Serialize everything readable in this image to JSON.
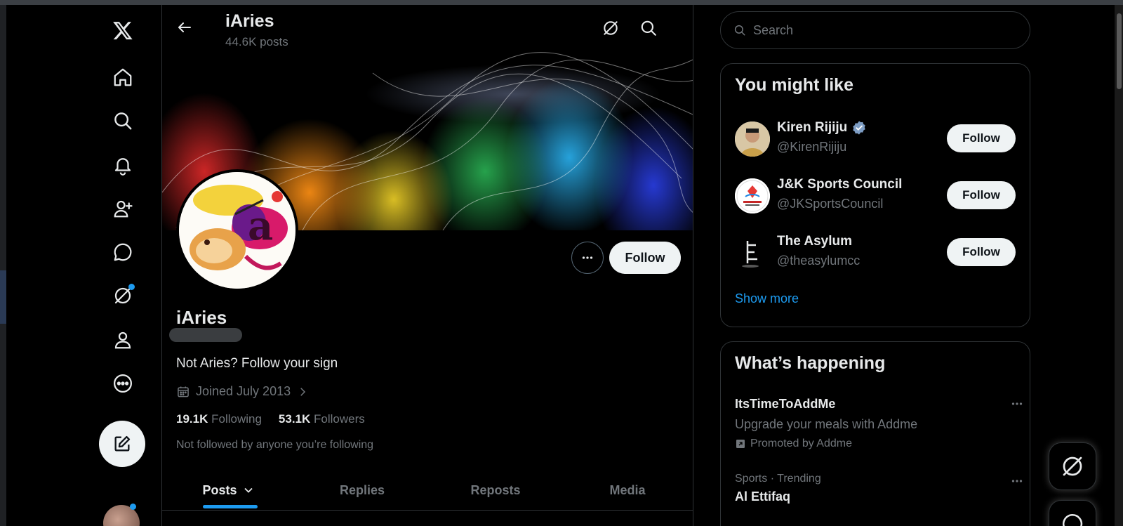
{
  "nav": {
    "icons": [
      "x-logo-icon",
      "home-icon",
      "explore-icon",
      "notifications-icon",
      "follow-icon",
      "messages-icon",
      "grok-icon",
      "profile-icon",
      "more-icon",
      "compose-icon"
    ]
  },
  "header": {
    "name": "iAries",
    "posts_count": "44.6K posts"
  },
  "profile": {
    "name": "iAries",
    "bio": "Not Aries? Follow your sign",
    "joined": "Joined July 2013",
    "following_count": "19.1K",
    "following_label": "Following",
    "followers_count": "53.1K",
    "followers_label": "Followers",
    "not_followed": "Not followed by anyone you’re following",
    "follow_label": "Follow"
  },
  "tabs": [
    {
      "label": "Posts",
      "active": true
    },
    {
      "label": "Replies",
      "active": false
    },
    {
      "label": "Reposts",
      "active": false
    },
    {
      "label": "Media",
      "active": false
    }
  ],
  "search": {
    "placeholder": "Search"
  },
  "who_to_follow": {
    "title": "You might like",
    "users": [
      {
        "name": "Kiren Rijiju",
        "handle": "@KirenRijiju",
        "verified": true,
        "follow_label": "Follow"
      },
      {
        "name": "J&K Sports Council",
        "handle": "@JKSportsCouncil",
        "verified": false,
        "follow_label": "Follow"
      },
      {
        "name": "The Asylum",
        "handle": "@theasylumcc",
        "verified": false,
        "follow_label": "Follow"
      }
    ],
    "show_more": "Show more"
  },
  "trends": {
    "title": "What’s happening",
    "items": [
      {
        "title": "ItsTimeToAddMe",
        "subtitle": "Upgrade your meals with Addme",
        "promoted": "Promoted by Addme"
      },
      {
        "context": "Sports · Trending",
        "title": "Al Ettifaq"
      }
    ]
  },
  "colors": {
    "accent": "#1d9bf0",
    "background": "#000000",
    "text_primary": "#e7e9ea",
    "text_secondary": "#71767b",
    "border": "#2f3336",
    "button_light": "#eff3f4"
  }
}
